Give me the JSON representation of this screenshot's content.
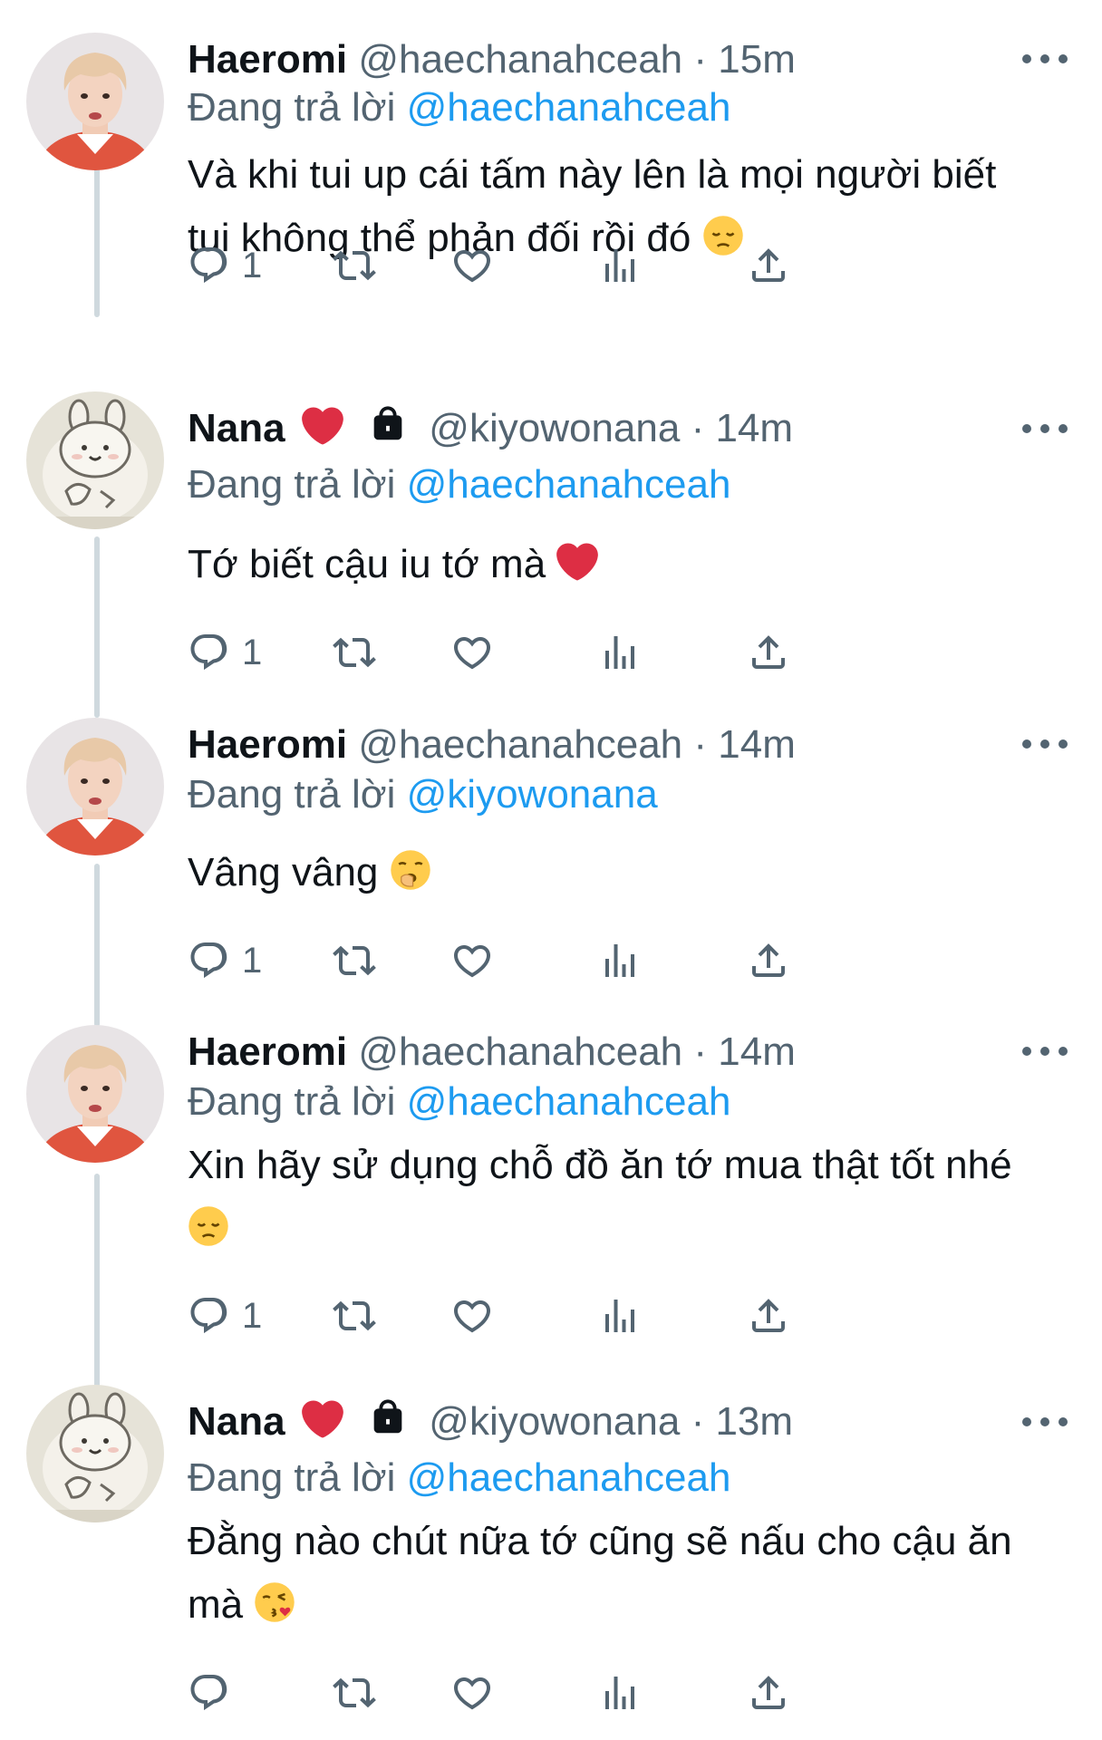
{
  "colors": {
    "text": "#0f1419",
    "secondary": "#536471",
    "mention": "#1d9bf0",
    "thread_line": "#cfd9de"
  },
  "icons": [
    "reply-icon",
    "retweet-icon",
    "like-icon",
    "views-icon",
    "share-icon",
    "more-icon",
    "lock-icon",
    "heart-emoji",
    "pensive-emoji",
    "yawning-emoji",
    "kiss-emoji"
  ],
  "tweets": [
    {
      "name": "Haeromi",
      "handle": "@haechanahceah",
      "sep": " · ",
      "time": "15m",
      "replying_prefix": "Đang trả lời ",
      "replying_to": "@haechanahceah",
      "text": "Và khi tui up cái tấm này lên là mọi người biết tui không thể phản đối rồi đó",
      "emoji": "pensive-emoji",
      "reply_count": "1"
    },
    {
      "name": "Nana",
      "handle": "@kiyowonana",
      "sep": " · ",
      "time": "14m",
      "replying_prefix": "Đang trả lời ",
      "replying_to": "@haechanahceah",
      "text": "Tớ biết cậu iu tớ mà",
      "emoji": "heart-emoji",
      "reply_count": "1"
    },
    {
      "name": "Haeromi",
      "handle": "@haechanahceah",
      "sep": " · ",
      "time": "14m",
      "replying_prefix": "Đang trả lời ",
      "replying_to": "@kiyowonana",
      "text": "Vâng vâng",
      "emoji": "yawning-emoji",
      "reply_count": "1"
    },
    {
      "name": "Haeromi",
      "handle": "@haechanahceah",
      "sep": " · ",
      "time": "14m",
      "replying_prefix": "Đang trả lời ",
      "replying_to": "@haechanahceah",
      "text": "Xin hãy sử dụng chỗ đồ ăn tớ mua thật tốt nhé",
      "emoji": "pensive-emoji",
      "reply_count": "1"
    },
    {
      "name": "Nana",
      "handle": "@kiyowonana",
      "sep": " · ",
      "time": "13m",
      "replying_prefix": "Đang trả lời ",
      "replying_to": "@haechanahceah",
      "text": "Đằng nào chút nữa tớ cũng sẽ nấu cho cậu ăn mà",
      "emoji": "kiss-emoji",
      "reply_count": ""
    }
  ]
}
